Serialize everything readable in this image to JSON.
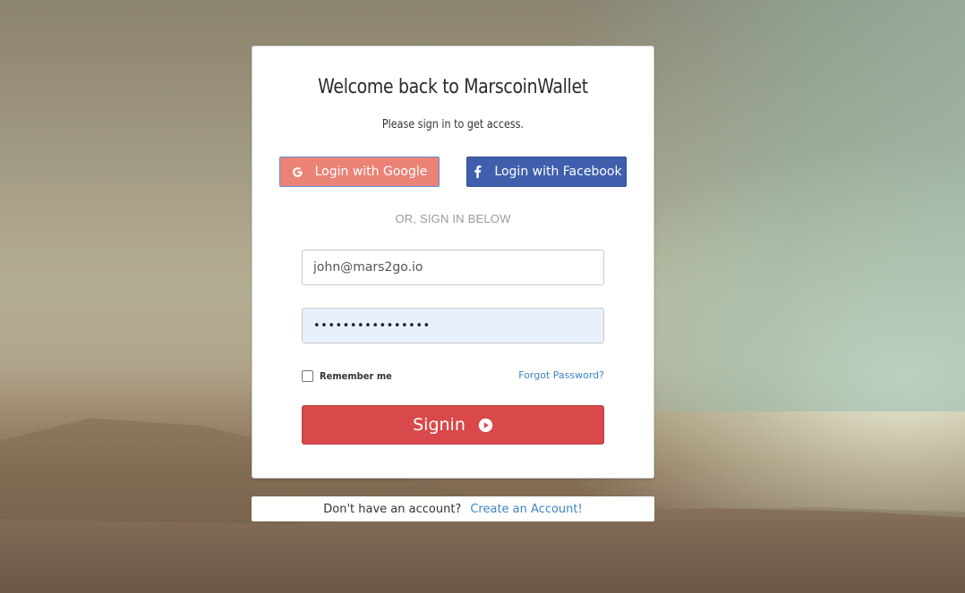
{
  "login_card": {
    "title": "Welcome back to MarscoinWallet",
    "subtitle": "Please sign in to get access.",
    "social": {
      "google_label": "Login with Google",
      "facebook_label": "Login with Facebook",
      "google_icon": "google-icon",
      "facebook_icon": "facebook-icon"
    },
    "divider": "OR, SIGN IN BELOW",
    "email_field": {
      "value": "john@mars2go.io"
    },
    "password_field": {
      "value": "••••••••••••••••"
    },
    "remember_label": "Remember me",
    "forgot_link": "Forgot Password?",
    "signin_label": "Signin",
    "signin_icon": "play-circle-icon"
  },
  "footer": {
    "text": "Don't have an account?",
    "link": "Create an Account!"
  },
  "colors": {
    "google": "#ea8276",
    "facebook": "#3f5fad",
    "signin": "#d9484a",
    "link": "#3d86c4",
    "password_autofill": "#e8f0fe"
  }
}
